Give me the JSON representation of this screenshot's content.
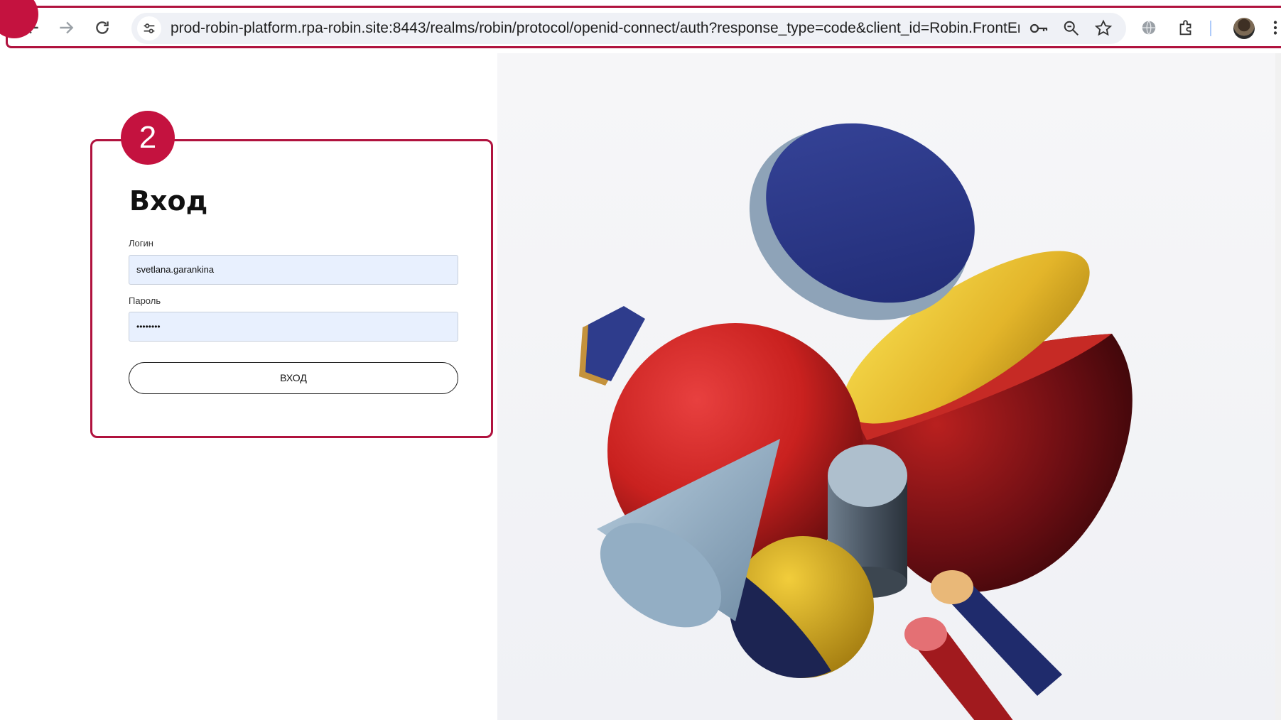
{
  "browser": {
    "url": "prod-robin-platform.rpa-robin.site:8443/realms/robin/protocol/openid-connect/auth?response_type=code&client_id=Robin.FrontEnd...",
    "icons": [
      "back-arrow-icon",
      "forward-arrow-icon",
      "reload-icon",
      "site-info-icon",
      "key-icon",
      "zoom-icon",
      "star-icon",
      "translate-icon",
      "extensions-icon",
      "avatar",
      "kebab-menu-icon"
    ]
  },
  "annotation": {
    "step_marker": "2"
  },
  "login": {
    "title": "Вход",
    "login_label": "Логин",
    "login_value": "svetlana.garankina",
    "password_label": "Пароль",
    "password_value": "••••••••",
    "submit_label": "ВХОД"
  },
  "colors": {
    "annotation_accent": "#c4123f",
    "field_fill": "#e8f0fe"
  }
}
